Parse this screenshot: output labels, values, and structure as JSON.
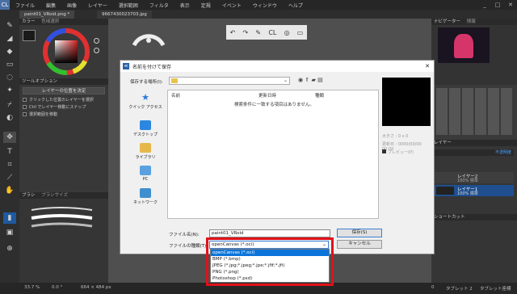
{
  "menubar": {
    "logo": "CL",
    "items": [
      "ファイル",
      "編集",
      "画像",
      "レイヤー",
      "選択範囲",
      "フィルタ",
      "表示",
      "定規",
      "イベント",
      "ウィンドウ",
      "ヘルプ"
    ],
    "window_controls": [
      "_",
      "□",
      "✕"
    ]
  },
  "tabs": {
    "tab1": "paint01_VRoid.png *",
    "tab2": "9667430023703.jpg"
  },
  "color_panel": {
    "title": "カラー",
    "title2": "色域選択"
  },
  "tool_option": {
    "title": "ツールオプション",
    "button": "レイヤーの位置を決定",
    "options": [
      "クリックした位置のレイヤーを選択",
      "Ctrl でレイヤー移動にスナップ",
      "選択範囲を移動"
    ]
  },
  "brush_panel": {
    "title": "ブラシ",
    "title2": "ブラシサイズ"
  },
  "navigator": {
    "title": "ナビゲーター",
    "title2": "情報"
  },
  "layers": {
    "tab": "レイヤー",
    "blend": "不透明度",
    "items": [
      {
        "name": "レイヤー2",
        "mode": "100% 標準"
      },
      {
        "name": "レイヤー1",
        "mode": "100% 標準"
      }
    ]
  },
  "shortcut": {
    "title": "ショートカット"
  },
  "status": {
    "zoom": "33.7 %",
    "angle": "0.0 °",
    "size": "664 × 484 px",
    "tablet": "タブレット 2",
    "mode": "タブレット座標",
    "count": "0"
  },
  "dialog": {
    "title": "名前を付けて保存",
    "close": "✕",
    "lookin_label": "保存する場所(I):",
    "places": [
      "クイック アクセス",
      "デスクトップ",
      "ライブラリ",
      "PC",
      "ネットワーク"
    ],
    "columns": [
      "名前",
      "更新日時",
      "種類"
    ],
    "empty_message": "検索条件に一致する項目はありません。",
    "preview_size": "大きさ : 0 x 0",
    "preview_date": "更新日 : 0000/00/00 00:00",
    "preview_check": "プレビュー(P)",
    "filename_label": "ファイル名(N):",
    "filename_value": "paint01_VRoid",
    "filetype_label": "ファイルの種類(T):",
    "filetype_value": "openCanvas (*.oci)",
    "save_button": "保存(S)",
    "cancel_button": "キャンセル",
    "filetype_options": [
      "openCanvas (*.oci)",
      "BMP (*.bmp)",
      "JPEG (*.jpg;*.jpeg;*.jpe;*.jfif;*.jfi)",
      "PNG (*.png)",
      "Photoshop (*.psd)"
    ]
  },
  "colors": {
    "highlight": "#e0121b",
    "selection": "#0a74da"
  }
}
